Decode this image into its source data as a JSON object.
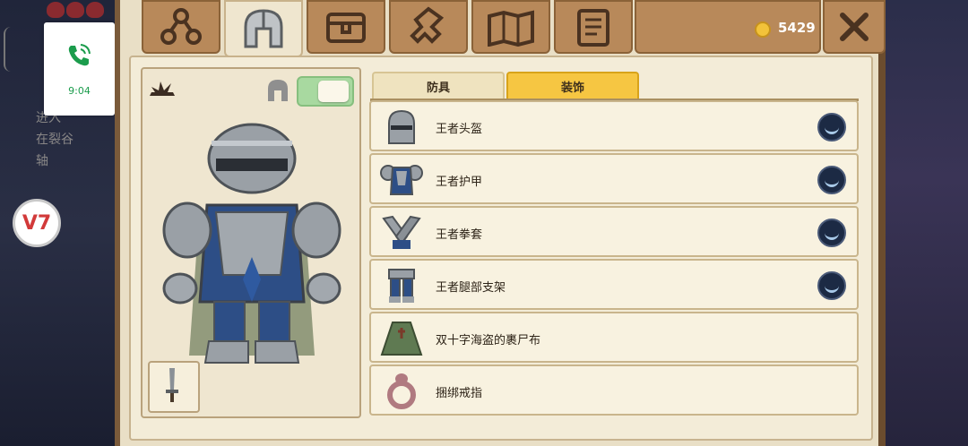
{
  "currency": {
    "gold": "5429"
  },
  "call_overlay": {
    "time": "9:04"
  },
  "background": {
    "quest_text_lines": [
      "进入",
      "在裂谷",
      "轴"
    ]
  },
  "tabs": [
    {
      "name": "tab-skills",
      "icon": "skill-tree-icon",
      "active": false
    },
    {
      "name": "tab-armor",
      "icon": "helmet-icon",
      "active": true
    },
    {
      "name": "tab-bag",
      "icon": "bag-icon",
      "active": false
    },
    {
      "name": "tab-crafting",
      "icon": "crafting-icon",
      "active": false
    },
    {
      "name": "tab-map",
      "icon": "map-icon",
      "active": false
    },
    {
      "name": "tab-quests",
      "icon": "scroll-icon",
      "active": false
    }
  ],
  "subtabs": [
    {
      "label": "防具",
      "active": false
    },
    {
      "label": "装饰",
      "active": true
    }
  ],
  "items": [
    {
      "label": "王者头盔",
      "icon": "helmet-item-icon",
      "status": true
    },
    {
      "label": "王者护甲",
      "icon": "chest-armor-icon",
      "status": true
    },
    {
      "label": "王者拳套",
      "icon": "gauntlets-icon",
      "status": true
    },
    {
      "label": "王者腿部支架",
      "icon": "leg-armor-icon",
      "status": true
    },
    {
      "label": "双十字海盗的裹尸布",
      "icon": "cape-icon",
      "status": false
    },
    {
      "label": "捆绑戒指",
      "icon": "ring-icon",
      "status": false
    }
  ],
  "preview": {
    "toggle_on": true
  },
  "colors": {
    "accent": "#f6c642",
    "toggle": "#a8d9a0",
    "gold": "#f2c23a"
  }
}
